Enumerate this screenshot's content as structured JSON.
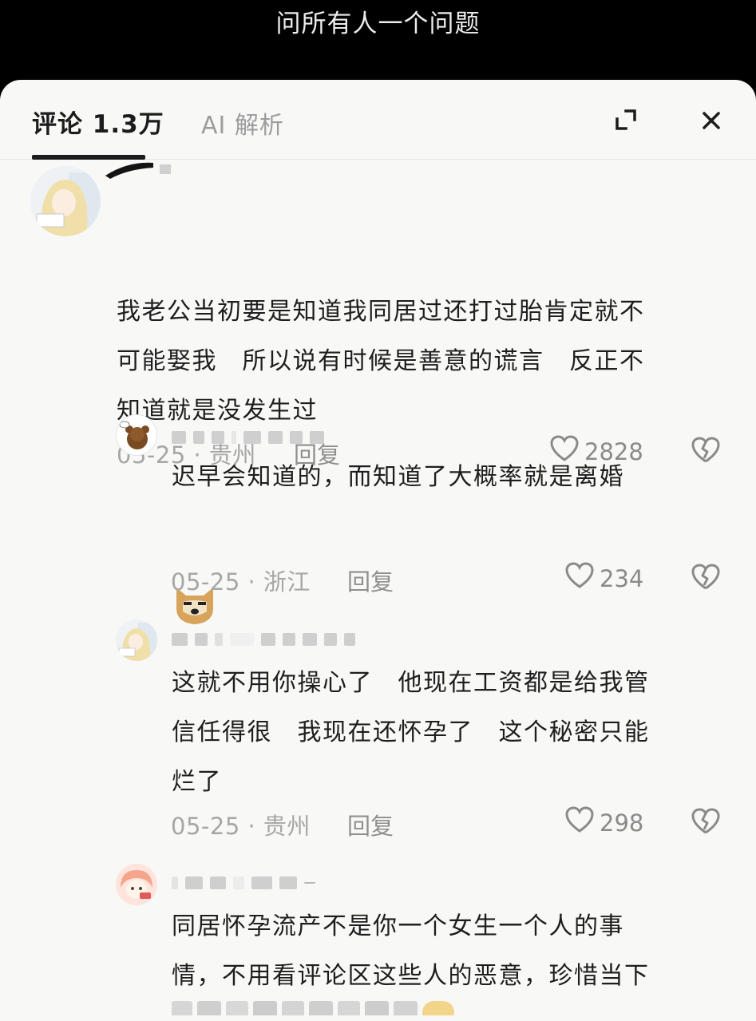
{
  "video": {
    "title": "问所有人一个问题"
  },
  "tabs": {
    "comments": "评论 1.3万",
    "ai": "AI 解析"
  },
  "comments": [
    {
      "lines": [
        "我老公当初要是知道我同居过还打过胎肯定就不",
        "可能娶我　所以说有时候是善意的谎言　反正不",
        "知道就是没发生过"
      ],
      "date": "05-25 · 贵州",
      "reply": "回复",
      "likes": "2828"
    },
    {
      "lines": [
        "迟早会知道的，而知道了大概率就是离婚"
      ],
      "emoji": "dog-face-emoji",
      "date": "05-25 · 浙江",
      "reply": "回复",
      "likes": "234"
    },
    {
      "lines": [
        "这就不用你操心了　他现在工资都是给我管",
        "信任得很　我现在还怀孕了　这个秘密只能",
        "烂了"
      ],
      "date": "05-25 · 贵州",
      "reply": "回复",
      "likes": "298"
    },
    {
      "lines": [
        "同居怀孕流产不是你一个女生一个人的事",
        "情，不用看评论区这些人的恶意，珍惜当下"
      ]
    }
  ],
  "colors": {
    "sheet": "#f8f8f7",
    "text": "#1e1e1e",
    "meta": "#a6a6a6",
    "accent": "#1c1c1c"
  }
}
